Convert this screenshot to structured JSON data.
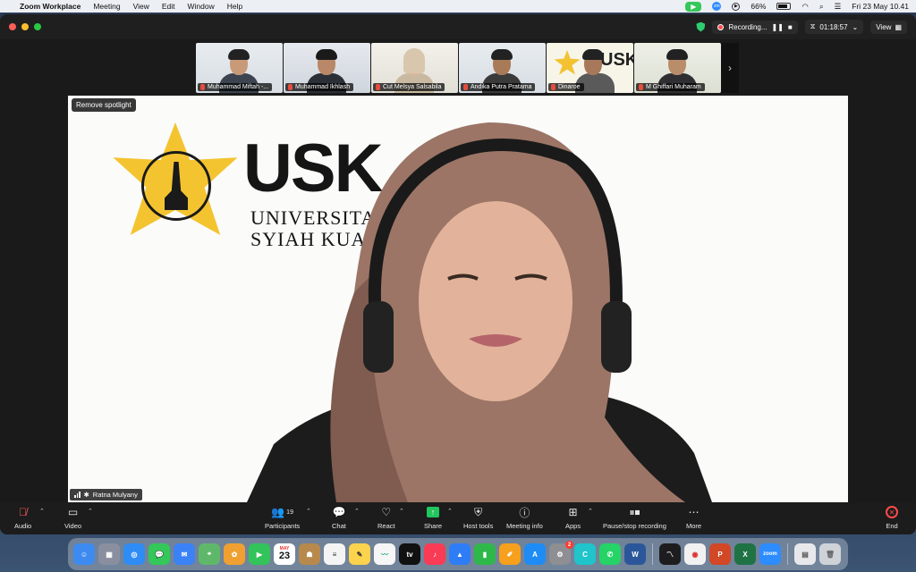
{
  "menubar": {
    "app_name": "Zoom Workplace",
    "menus": [
      "Meeting",
      "View",
      "Edit",
      "Window",
      "Help"
    ],
    "battery": "66%",
    "battery_level": 0.66,
    "datetime": "Fri 23 May  10.41"
  },
  "titlebar": {
    "recording_label": "Recording...",
    "timer": "01:18:57",
    "view_label": "View"
  },
  "gallery": [
    {
      "name": "Muhammad Miftah -..."
    },
    {
      "name": "Muhammad Ikhlash"
    },
    {
      "name": "Cut Melsya Salsabila"
    },
    {
      "name": "Andika Putra Pratama"
    },
    {
      "name": "Dinaroe"
    },
    {
      "name": "M Ghiffari Muharam"
    }
  ],
  "spotlight": {
    "remove_label": "Remove spotlight",
    "speaker_name": "Ratna Mulyany",
    "background_logo": "USK",
    "background_line1": "UNIVERSITA",
    "background_line2": "SYIAH KUAL"
  },
  "toolbar": {
    "audio": "Audio",
    "video": "Video",
    "participants": "Participants",
    "participants_count": "19",
    "chat": "Chat",
    "react": "React",
    "share": "Share",
    "host_tools": "Host tools",
    "meeting_info": "Meeting info",
    "apps": "Apps",
    "pause_stop_recording": "Pause/stop recording",
    "more": "More",
    "end": "End"
  },
  "dock": {
    "calendar_month": "MAY",
    "calendar_day": "23",
    "apps": [
      "Finder",
      "Launchpad",
      "Safari",
      "Messages",
      "Mail",
      "Maps",
      "Photos",
      "FaceTime",
      "Calendar",
      "Contacts",
      "Reminders",
      "Notes",
      "Freeform",
      "TV",
      "Music",
      "Keynote",
      "Numbers",
      "Pages",
      "App Store",
      "System Settings",
      "Canva",
      "WhatsApp",
      "Word",
      "Activity Monitor",
      "Chrome",
      "PowerPoint",
      "Excel",
      "Zoom",
      "Scanner",
      "Trash"
    ],
    "settings_badge": "2",
    "zoom_label": "zoom"
  }
}
